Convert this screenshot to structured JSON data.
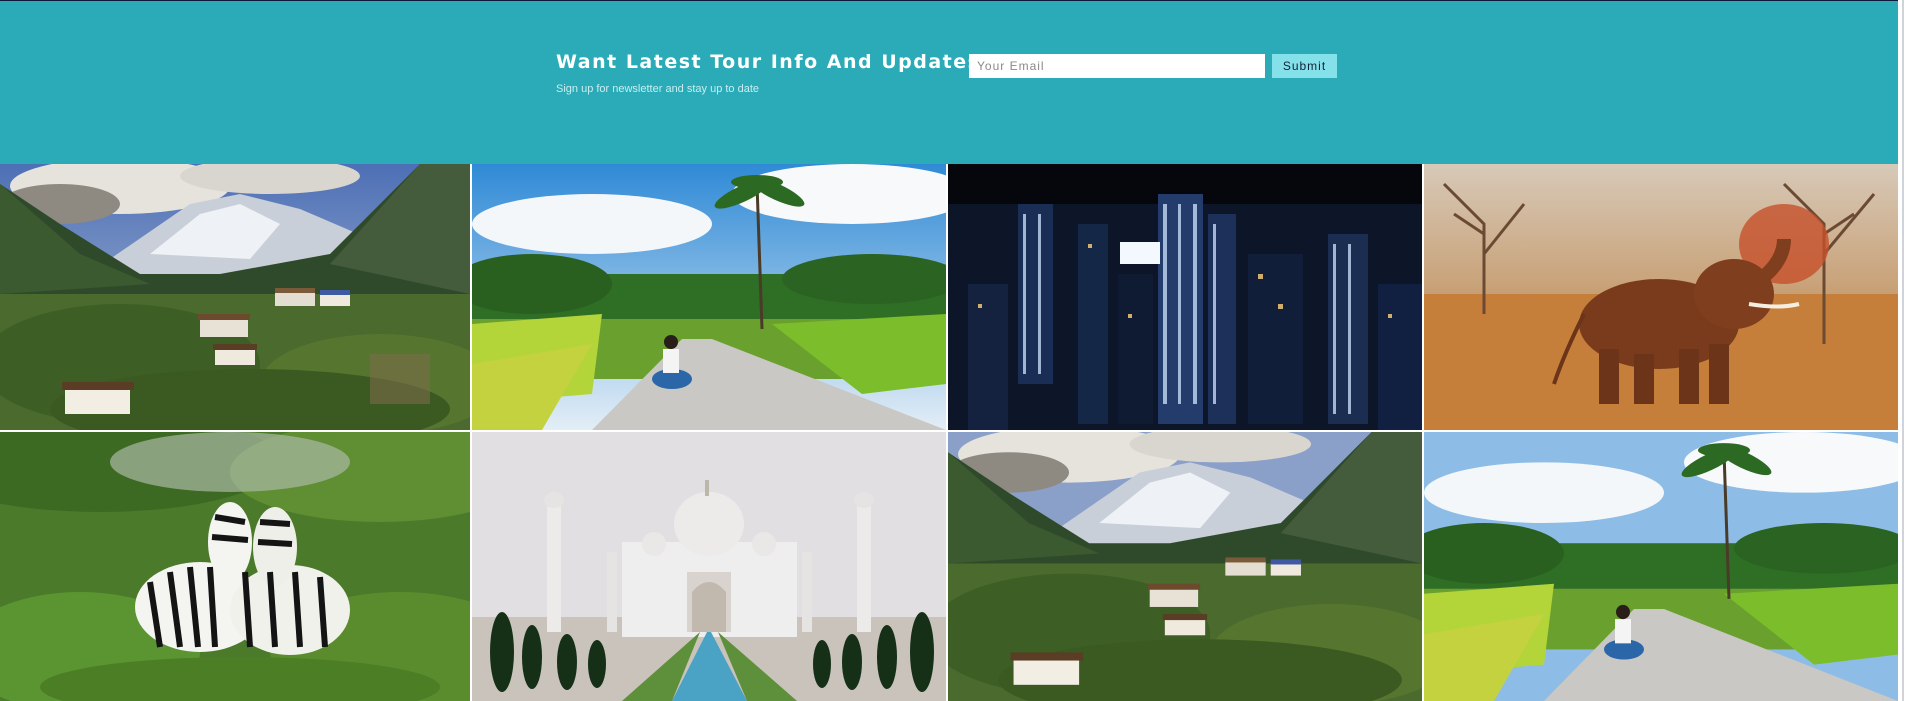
{
  "newsletter": {
    "title": "Want Latest Tour Info And Updates?",
    "subtitle": "Sign up for newsletter and stay up to date",
    "email_placeholder": "Your Email",
    "submit_label": "Submit",
    "background_color": "#2aabb7",
    "button_color": "#84e1ea"
  },
  "gallery": {
    "tiles": [
      {
        "subject": "mountain valley village"
      },
      {
        "subject": "woman sitting on tropical road"
      },
      {
        "subject": "city skyline at night"
      },
      {
        "subject": "elephant throwing dust"
      },
      {
        "subject": "two zebras in grass"
      },
      {
        "subject": "taj mahal"
      },
      {
        "subject": "mountain valley village"
      },
      {
        "subject": "woman sitting on tropical road"
      }
    ]
  }
}
